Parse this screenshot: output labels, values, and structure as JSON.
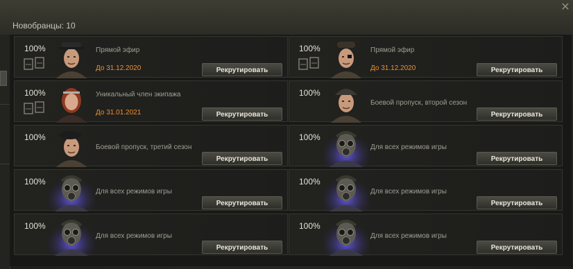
{
  "window": {
    "title": "Новобранцы: 10",
    "close_icon": "close-icon"
  },
  "accent": "#f0902e",
  "recruits": [
    {
      "percent": "100%",
      "label": "Прямой эфир",
      "date": "До 31.12.2020",
      "button": "Рекрутировать",
      "portrait": "headset-officer",
      "badge": true
    },
    {
      "percent": "100%",
      "label": "Прямой эфир",
      "date": "До 31.12.2020",
      "button": "Рекрутировать",
      "portrait": "eyepatch-tanker",
      "badge": true
    },
    {
      "percent": "100%",
      "label": "Уникальный член экипажа",
      "date": "До 31.01.2021",
      "button": "Рекрутировать",
      "portrait": "red-haired-woman",
      "badge": true
    },
    {
      "percent": "100%",
      "label": "Боевой пропуск, второй сезон",
      "date": "",
      "button": "Рекрутировать",
      "portrait": "helmet-tanker",
      "badge": false
    },
    {
      "percent": "100%",
      "label": "Боевой пропуск, третий сезон",
      "date": "",
      "button": "Рекрутировать",
      "portrait": "beret-soldier",
      "badge": false
    },
    {
      "percent": "100%",
      "label": "Для всех режимов игры",
      "date": "",
      "button": "Рекрутировать",
      "portrait": "gas-mask",
      "badge": false
    },
    {
      "percent": "100%",
      "label": "Для всех режимов игры",
      "date": "",
      "button": "Рекрутировать",
      "portrait": "gas-mask",
      "badge": false
    },
    {
      "percent": "100%",
      "label": "Для всех режимов игры",
      "date": "",
      "button": "Рекрутировать",
      "portrait": "gas-mask",
      "badge": false
    },
    {
      "percent": "100%",
      "label": "Для всех режимов игры",
      "date": "",
      "button": "Рекрутировать",
      "portrait": "gas-mask",
      "badge": false
    },
    {
      "percent": "100%",
      "label": "Для всех режимов игры",
      "date": "",
      "button": "Рекрутировать",
      "portrait": "gas-mask",
      "badge": false
    }
  ]
}
